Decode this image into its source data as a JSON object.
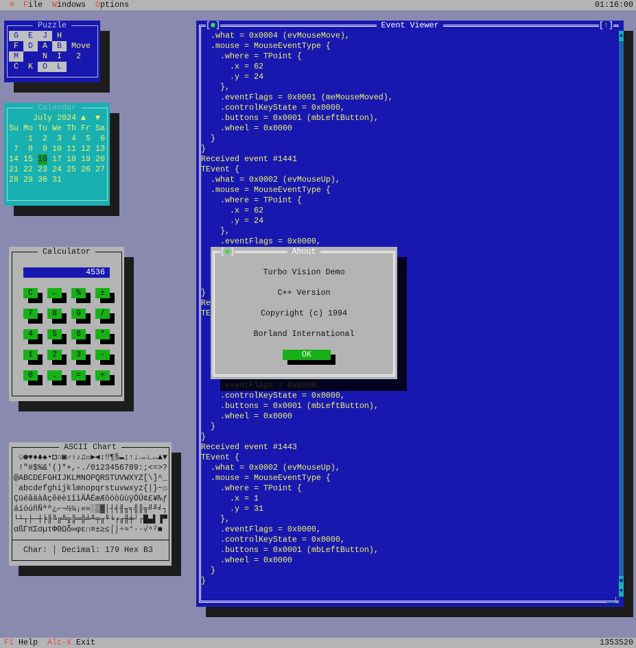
{
  "menu": {
    "system_icon": "≡",
    "items": [
      {
        "hot": "F",
        "rest": "ile"
      },
      {
        "hot": "W",
        "rest": "indows"
      },
      {
        "hot": "O",
        "rest": "ptions"
      }
    ],
    "clock": "01:16:00"
  },
  "status": {
    "items": [
      {
        "key": "F1",
        "label": "Help"
      },
      {
        "key": "Alt-X",
        "label": "Exit"
      }
    ],
    "memory": "1353520"
  },
  "colors": {
    "desktop": "#8a8ab0",
    "blue_window": "#1818b0",
    "teal_window": "#18b0b0",
    "gray_window": "#b4b4b4",
    "text_yellow": "#f0f070",
    "button_green": "#18b018",
    "hotkey_red": "#e04848"
  },
  "puzzle": {
    "title": "Puzzle",
    "tiles": [
      [
        {
          "ch": "G",
          "gray": true
        },
        {
          "ch": "E",
          "gray": true
        },
        {
          "ch": "J",
          "gray": true
        },
        {
          "ch": "H",
          "gray": false
        }
      ],
      [
        {
          "ch": "F",
          "gray": false
        },
        {
          "ch": "D",
          "gray": true
        },
        {
          "ch": "A",
          "gray": false
        },
        {
          "ch": "B",
          "gray": true
        }
      ],
      [
        {
          "ch": "M",
          "gray": true
        },
        {
          "ch": "",
          "gray": false
        },
        {
          "ch": "N",
          "gray": false
        },
        {
          "ch": "I",
          "gray": false
        }
      ],
      [
        {
          "ch": "C",
          "gray": false
        },
        {
          "ch": "K",
          "gray": false
        },
        {
          "ch": "O",
          "gray": true
        },
        {
          "ch": "L",
          "gray": true
        }
      ]
    ],
    "move_label": "Move",
    "move_count": "2"
  },
  "calendar": {
    "title": "Calendar",
    "month": "July 2024",
    "up_icon": "▲",
    "down_icon": "▼",
    "weekdays": [
      "Su",
      "Mo",
      "Tu",
      "We",
      "Th",
      "Fr",
      "Sa"
    ],
    "weeks": [
      [
        "",
        "1",
        "2",
        "3",
        "4",
        "5",
        "6"
      ],
      [
        "7",
        "8",
        "9",
        "10",
        "11",
        "12",
        "13"
      ],
      [
        "14",
        "15",
        "16",
        "17",
        "18",
        "19",
        "20"
      ],
      [
        "21",
        "22",
        "23",
        "24",
        "25",
        "26",
        "27"
      ],
      [
        "28",
        "29",
        "30",
        "31",
        "",
        "",
        ""
      ]
    ],
    "today": "16"
  },
  "calculator": {
    "title": "Calculator",
    "display": "4536",
    "buttons": [
      [
        "C",
        "←",
        "%",
        "±"
      ],
      [
        "7",
        "8",
        "9",
        "/"
      ],
      [
        "4",
        "5",
        "6",
        "*"
      ],
      [
        "1",
        "2",
        "3",
        "-"
      ],
      [
        "0",
        ".",
        "=",
        "+"
      ]
    ]
  },
  "ascii_chart": {
    "title": "ASCII Chart",
    "rows": [
      " ☺☻♥♦♣♠•◘○◙♂♀♪♫☼►◄↕‼¶§▬↨↑↓→←∟↔▲▼",
      " !\"#$%&'()*+,-./0123456789:;<=>?",
      "@ABCDEFGHIJKLMNOPQRSTUVWXYZ[\\]^_",
      "`abcdefghijklmnopqrstuvwxyz{|}~⌂",
      "ÇüéâäàåçêëèïîìÄÅÉæÆôöòûùÿÖÜ¢£¥₧ƒ",
      "áíóúñÑªº¿⌐¬½¼¡«»░▒▓│┤╡╢╖╕╣║╗╝╜╛┐",
      "└┴┬├─┼╞╟╚╔╩╦╠═╬╧╨╤╥╙╘╒╓╫╪┘┌█▄▌▐▀",
      "αßΓπΣσµτΦΘΩδ∞φε∩≡±≥≤⌠⌡÷≈°∙·√ⁿ²■ "
    ],
    "char_label": "Char:",
    "char_value": "│",
    "decimal_label": "Decimal:",
    "decimal_value": "179",
    "hex_label": "Hex",
    "hex_value": "B3"
  },
  "event_viewer": {
    "title": "Event Viewer",
    "close_icon": "■",
    "zoom_icon": "↑",
    "lines": [
      "  .what = 0x0004 (evMouseMove),",
      "  .mouse = MouseEventType {",
      "    .where = TPoint {",
      "      .x = 62",
      "      .y = 24",
      "    },",
      "    .eventFlags = 0x0001 (meMouseMoved),",
      "    .controlKeyState = 0x0000,",
      "    .buttons = 0x0001 (mbLeftButton),",
      "    .wheel = 0x0000",
      "  }",
      "}",
      "Received event #1441",
      "TEvent {",
      "  .what = 0x0002 (evMouseUp),",
      "  .mouse = MouseEventType {",
      "    .where = TPoint {",
      "      .x = 62",
      "      .y = 24",
      "    },",
      "    .eventFlags = 0x0000,",
      "",
      "",
      "",
      "",
      "}",
      "Re",
      "TE",
      "",
      "",
      "",
      "",
      "",
      "",
      "    .eventFlags = 0x0000,",
      "    .controlKeyState = 0x0000,",
      "    .buttons = 0x0001 (mbLeftButton),",
      "    .wheel = 0x0000",
      "  }",
      "}",
      "Received event #1443",
      "TEvent {",
      "  .what = 0x0002 (evMouseUp),",
      "  .mouse = MouseEventType {",
      "    .where = TPoint {",
      "      .x = 1",
      "      .y = 31",
      "    },",
      "    .eventFlags = 0x0000,",
      "    .controlKeyState = 0x0000,",
      "    .buttons = 0x0001 (mbLeftButton),",
      "    .wheel = 0x0000",
      "  }",
      "}"
    ]
  },
  "about": {
    "title": "About",
    "close_icon": "■",
    "lines": [
      "Turbo Vision Demo",
      "C++ Version",
      "Copyright (c) 1994",
      "Borland International"
    ],
    "ok_label": "OK"
  }
}
